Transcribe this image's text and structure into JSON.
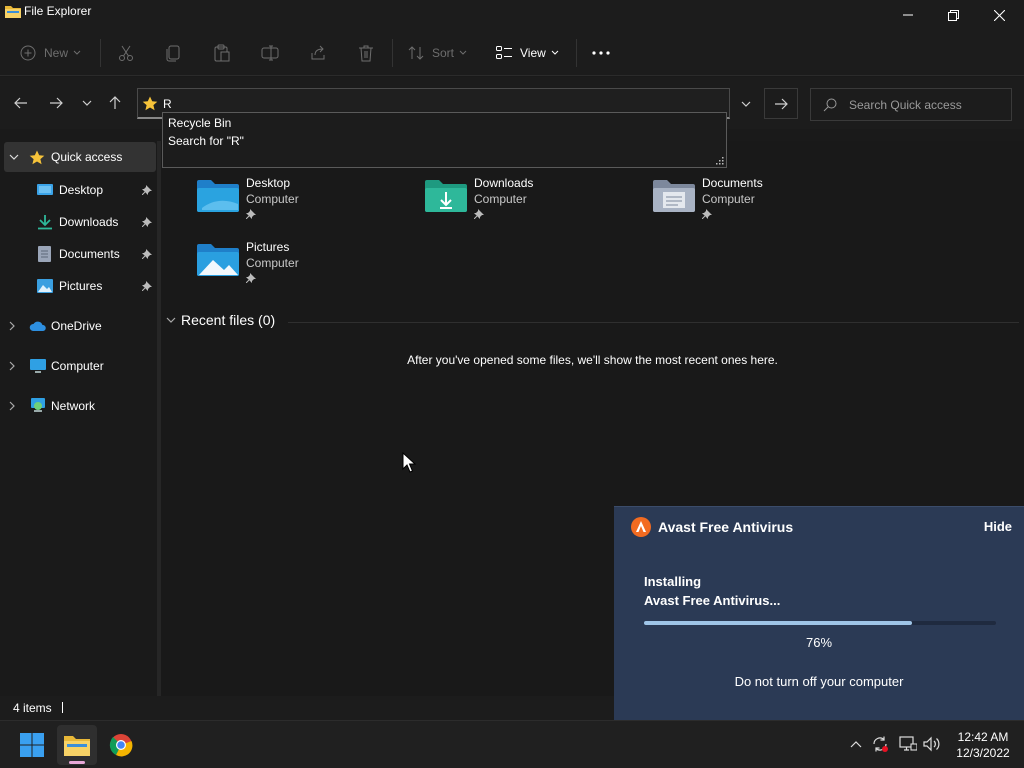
{
  "window": {
    "title": "File Explorer"
  },
  "commandbar": {
    "new_label": "New",
    "sort_label": "Sort",
    "view_label": "View"
  },
  "address": {
    "value": "R",
    "suggestions": [
      "Recycle Bin",
      "Search for \"R\""
    ]
  },
  "search": {
    "placeholder": "Search Quick access"
  },
  "sidebar": {
    "quick_access": "Quick access",
    "pinned": [
      {
        "label": "Desktop",
        "icon": "desktop-icon"
      },
      {
        "label": "Downloads",
        "icon": "download-icon"
      },
      {
        "label": "Documents",
        "icon": "document-icon"
      },
      {
        "label": "Pictures",
        "icon": "picture-icon"
      }
    ],
    "onedrive": "OneDrive",
    "computer": "Computer",
    "network": "Network"
  },
  "folders": [
    {
      "name": "Desktop",
      "location": "Computer",
      "color": "#2aa3e0"
    },
    {
      "name": "Downloads",
      "location": "Computer",
      "color": "#2eb89a"
    },
    {
      "name": "Documents",
      "location": "Computer",
      "color": "#9aa5b8"
    },
    {
      "name": "Pictures",
      "location": "Computer",
      "color": "#2a9fe0"
    }
  ],
  "recent": {
    "header": "Recent files (0)",
    "empty_message": "After you've opened some files, we'll show the most recent ones here."
  },
  "status": {
    "item_count": "4 items"
  },
  "toast": {
    "brand": "Avast Free Antivirus",
    "hide_label": "Hide",
    "status_line1": "Installing",
    "status_line2": "Avast Free Antivirus...",
    "progress": 0.76,
    "percent_label": "76%",
    "warning": "Do not turn off your computer",
    "accent": "#f26b21"
  },
  "taskbar": {
    "time": "12:42 AM",
    "date": "12/3/2022"
  }
}
